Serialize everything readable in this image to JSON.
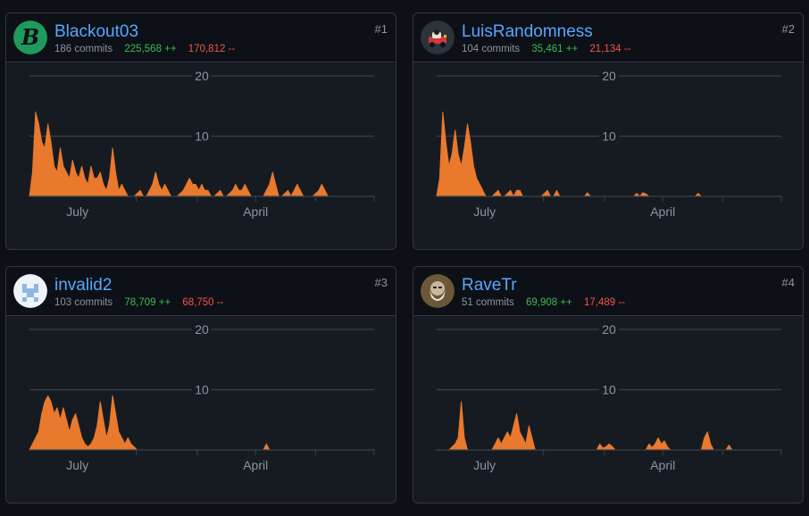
{
  "colors": {
    "background": "#0d1117",
    "card": "#161b22",
    "border": "#30363d",
    "link": "#58a6ff",
    "additions": "#3fb950",
    "deletions": "#f85149",
    "area": "#e8792d"
  },
  "contributors": [
    {
      "rank": "#1",
      "name": "Blackout03",
      "commits": "186 commits",
      "additions": "225,568 ++",
      "deletions": "170,812 --",
      "avatar_icon": "b-letter-avatar-icon",
      "chart_data": {
        "type": "area",
        "y_ticks": [
          "20",
          "10"
        ],
        "ylim": [
          0,
          20
        ],
        "x_labels": [
          "July",
          "April"
        ],
        "x_range": [
          0,
          56
        ],
        "points": [
          [
            0,
            0
          ],
          [
            0.5,
            4
          ],
          [
            1,
            14
          ],
          [
            1.5,
            12
          ],
          [
            2,
            9
          ],
          [
            2.5,
            8
          ],
          [
            3,
            12
          ],
          [
            3.5,
            9
          ],
          [
            4,
            5
          ],
          [
            4.5,
            4
          ],
          [
            5,
            8
          ],
          [
            5.5,
            5
          ],
          [
            6,
            4
          ],
          [
            6.5,
            3
          ],
          [
            7,
            6
          ],
          [
            7.5,
            4
          ],
          [
            8,
            3
          ],
          [
            8.5,
            5
          ],
          [
            9,
            3
          ],
          [
            9.5,
            2
          ],
          [
            10,
            5
          ],
          [
            10.5,
            3
          ],
          [
            11,
            3
          ],
          [
            11.5,
            4
          ],
          [
            12,
            2
          ],
          [
            12.5,
            1
          ],
          [
            13,
            3
          ],
          [
            13.5,
            8
          ],
          [
            14,
            4
          ],
          [
            14.5,
            1
          ],
          [
            15,
            2
          ],
          [
            15.5,
            1
          ],
          [
            16,
            0
          ],
          [
            17,
            0
          ],
          [
            18,
            1
          ],
          [
            18.5,
            0
          ],
          [
            19,
            0
          ],
          [
            19.5,
            1
          ],
          [
            20,
            2
          ],
          [
            20.5,
            4
          ],
          [
            21,
            2
          ],
          [
            21.5,
            1
          ],
          [
            22,
            2
          ],
          [
            22.5,
            1
          ],
          [
            23,
            0
          ],
          [
            24,
            0
          ],
          [
            25,
            1
          ],
          [
            25.5,
            2
          ],
          [
            26,
            3
          ],
          [
            26.5,
            2
          ],
          [
            27,
            2
          ],
          [
            27.5,
            1
          ],
          [
            28,
            2
          ],
          [
            28.5,
            1
          ],
          [
            29,
            1
          ],
          [
            29.5,
            0
          ],
          [
            30,
            0
          ],
          [
            31,
            1
          ],
          [
            31.5,
            0
          ],
          [
            32,
            0
          ],
          [
            33,
            1
          ],
          [
            33.5,
            2
          ],
          [
            34,
            1
          ],
          [
            34.5,
            1
          ],
          [
            35,
            2
          ],
          [
            35.5,
            1
          ],
          [
            36,
            0
          ],
          [
            38,
            0
          ],
          [
            39,
            2
          ],
          [
            39.5,
            4
          ],
          [
            40,
            2
          ],
          [
            40.5,
            0
          ],
          [
            41,
            0
          ],
          [
            42,
            1
          ],
          [
            42.5,
            0
          ],
          [
            43,
            1
          ],
          [
            43.5,
            2
          ],
          [
            44,
            1
          ],
          [
            44.5,
            0
          ],
          [
            46,
            0
          ],
          [
            47,
            1
          ],
          [
            47.5,
            2
          ],
          [
            48,
            1
          ],
          [
            48.5,
            0
          ],
          [
            56,
            0
          ]
        ]
      }
    },
    {
      "rank": "#2",
      "name": "LuisRandomness",
      "commits": "104 commits",
      "additions": "35,461 ++",
      "deletions": "21,134 --",
      "avatar_icon": "car-avatar-icon",
      "chart_data": {
        "type": "area",
        "y_ticks": [
          "20",
          "10"
        ],
        "ylim": [
          0,
          20
        ],
        "x_labels": [
          "July",
          "April"
        ],
        "x_range": [
          0,
          56
        ],
        "points": [
          [
            0,
            0
          ],
          [
            0.5,
            3
          ],
          [
            1,
            14
          ],
          [
            1.5,
            9
          ],
          [
            2,
            5
          ],
          [
            2.5,
            7
          ],
          [
            3,
            11
          ],
          [
            3.5,
            7
          ],
          [
            4,
            5
          ],
          [
            4.5,
            8
          ],
          [
            5,
            12
          ],
          [
            5.5,
            9
          ],
          [
            6,
            5
          ],
          [
            6.5,
            3
          ],
          [
            7,
            2
          ],
          [
            7.5,
            1
          ],
          [
            8,
            0
          ],
          [
            9,
            0
          ],
          [
            10,
            1
          ],
          [
            10.5,
            0
          ],
          [
            11,
            0
          ],
          [
            12,
            1
          ],
          [
            12.5,
            0
          ],
          [
            13,
            1
          ],
          [
            13.5,
            1
          ],
          [
            14,
            0
          ],
          [
            17,
            0
          ],
          [
            18,
            1
          ],
          [
            18.5,
            0
          ],
          [
            19,
            0
          ],
          [
            19.5,
            1
          ],
          [
            20,
            0
          ],
          [
            24,
            0
          ],
          [
            24.5,
            0.6
          ],
          [
            25,
            0
          ],
          [
            32,
            0
          ],
          [
            32.5,
            0.5
          ],
          [
            33,
            0
          ],
          [
            33.5,
            0.6
          ],
          [
            34,
            0.4
          ],
          [
            34.5,
            0
          ],
          [
            42,
            0
          ],
          [
            42.5,
            0.5
          ],
          [
            43,
            0
          ],
          [
            56,
            0
          ]
        ]
      }
    },
    {
      "rank": "#3",
      "name": "invalid2",
      "commits": "103 commits",
      "additions": "78,709 ++",
      "deletions": "68,750 --",
      "avatar_icon": "pixel-avatar-icon",
      "chart_data": {
        "type": "area",
        "y_ticks": [
          "20",
          "10"
        ],
        "ylim": [
          0,
          20
        ],
        "x_labels": [
          "July",
          "April"
        ],
        "x_range": [
          0,
          56
        ],
        "points": [
          [
            0,
            0
          ],
          [
            0.5,
            1
          ],
          [
            1,
            2
          ],
          [
            1.5,
            3
          ],
          [
            2,
            6
          ],
          [
            2.5,
            8
          ],
          [
            3,
            9
          ],
          [
            3.5,
            8
          ],
          [
            4,
            6
          ],
          [
            4.5,
            7
          ],
          [
            5,
            5
          ],
          [
            5.5,
            7
          ],
          [
            6,
            5
          ],
          [
            6.5,
            3
          ],
          [
            7,
            5
          ],
          [
            7.5,
            6
          ],
          [
            8,
            4
          ],
          [
            8.5,
            2
          ],
          [
            9,
            1
          ],
          [
            9.5,
            0.5
          ],
          [
            10,
            1
          ],
          [
            10.5,
            2
          ],
          [
            11,
            4
          ],
          [
            11.5,
            8
          ],
          [
            12,
            5
          ],
          [
            12.5,
            2
          ],
          [
            13,
            4
          ],
          [
            13.5,
            9
          ],
          [
            14,
            6
          ],
          [
            14.5,
            3
          ],
          [
            15,
            2
          ],
          [
            15.5,
            1
          ],
          [
            16,
            2
          ],
          [
            16.5,
            1
          ],
          [
            17,
            0.5
          ],
          [
            17.5,
            0
          ],
          [
            38,
            0
          ],
          [
            38.5,
            1
          ],
          [
            39,
            0
          ],
          [
            56,
            0
          ]
        ]
      }
    },
    {
      "rank": "#4",
      "name": "RaveTr",
      "commits": "51 commits",
      "additions": "69,908 ++",
      "deletions": "17,489 --",
      "avatar_icon": "bearded-man-avatar-icon",
      "chart_data": {
        "type": "area",
        "y_ticks": [
          "20",
          "10"
        ],
        "ylim": [
          0,
          20
        ],
        "x_labels": [
          "July",
          "April"
        ],
        "x_range": [
          0,
          56
        ],
        "points": [
          [
            0,
            0
          ],
          [
            2,
            0
          ],
          [
            2.5,
            0.5
          ],
          [
            3,
            1
          ],
          [
            3.5,
            2
          ],
          [
            4,
            8
          ],
          [
            4.5,
            2
          ],
          [
            5,
            0
          ],
          [
            9,
            0
          ],
          [
            9.5,
            1
          ],
          [
            10,
            2
          ],
          [
            10.5,
            1
          ],
          [
            11,
            2
          ],
          [
            11.5,
            3
          ],
          [
            12,
            2
          ],
          [
            12.5,
            4
          ],
          [
            13,
            6
          ],
          [
            13.5,
            3
          ],
          [
            14,
            2
          ],
          [
            14.5,
            1
          ],
          [
            15,
            4
          ],
          [
            15.5,
            2
          ],
          [
            16,
            0
          ],
          [
            26,
            0
          ],
          [
            26.5,
            1
          ],
          [
            27,
            0.3
          ],
          [
            27.5,
            0.5
          ],
          [
            28,
            1
          ],
          [
            28.5,
            0.6
          ],
          [
            29,
            0
          ],
          [
            34,
            0
          ],
          [
            34.5,
            1
          ],
          [
            35,
            0.4
          ],
          [
            35.5,
            1
          ],
          [
            36,
            2
          ],
          [
            36.5,
            1
          ],
          [
            37,
            1.5
          ],
          [
            37.5,
            0.5
          ],
          [
            38,
            0
          ],
          [
            43,
            0
          ],
          [
            43.5,
            2
          ],
          [
            44,
            3
          ],
          [
            44.5,
            1
          ],
          [
            45,
            0
          ],
          [
            47,
            0
          ],
          [
            47.5,
            0.8
          ],
          [
            48,
            0
          ],
          [
            56,
            0
          ]
        ]
      }
    }
  ]
}
